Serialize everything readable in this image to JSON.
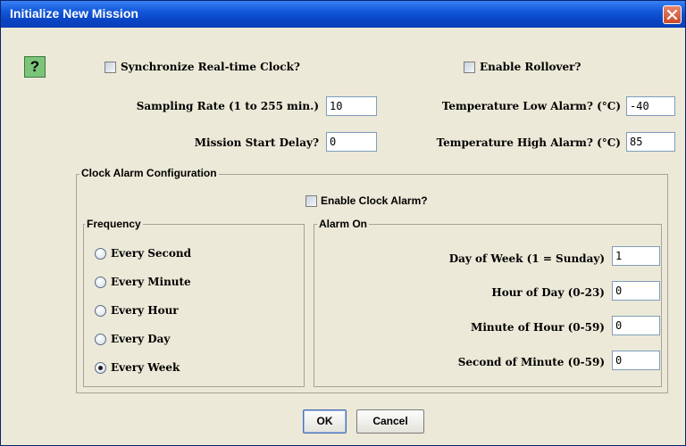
{
  "window": {
    "title": "Initialize New Mission",
    "close_icon": "close-icon"
  },
  "help": {
    "label": "?",
    "icon": "help-icon"
  },
  "top": {
    "sync_clock": {
      "label": "Synchronize Real-time Clock?",
      "checked": false
    },
    "rollover": {
      "label": "Enable Rollover?",
      "checked": false
    },
    "sampling_rate": {
      "label": "Sampling Rate (1 to 255 min.)",
      "value": "10"
    },
    "start_delay": {
      "label": "Mission Start Delay?",
      "value": "0"
    },
    "temp_low": {
      "label": "Temperature Low Alarm? (°C)",
      "value": "-40"
    },
    "temp_high": {
      "label": "Temperature High Alarm? (°C)",
      "value": "85"
    }
  },
  "clock_alarm": {
    "title": "Clock Alarm Configuration",
    "enable": {
      "label": "Enable Clock Alarm?",
      "checked": false
    },
    "frequency": {
      "title": "Frequency",
      "options": [
        {
          "label": "Every Second",
          "selected": false
        },
        {
          "label": "Every Minute",
          "selected": false
        },
        {
          "label": "Every Hour",
          "selected": false
        },
        {
          "label": "Every Day",
          "selected": false
        },
        {
          "label": "Every Week",
          "selected": true
        }
      ]
    },
    "alarm_on": {
      "title": "Alarm On",
      "fields": [
        {
          "label": "Day of Week (1 = Sunday)",
          "value": "1"
        },
        {
          "label": "Hour of Day (0-23)",
          "value": "0"
        },
        {
          "label": "Minute of Hour (0-59)",
          "value": "0"
        },
        {
          "label": "Second of Minute (0-59)",
          "value": "0"
        }
      ]
    }
  },
  "buttons": {
    "ok": "OK",
    "cancel": "Cancel"
  }
}
